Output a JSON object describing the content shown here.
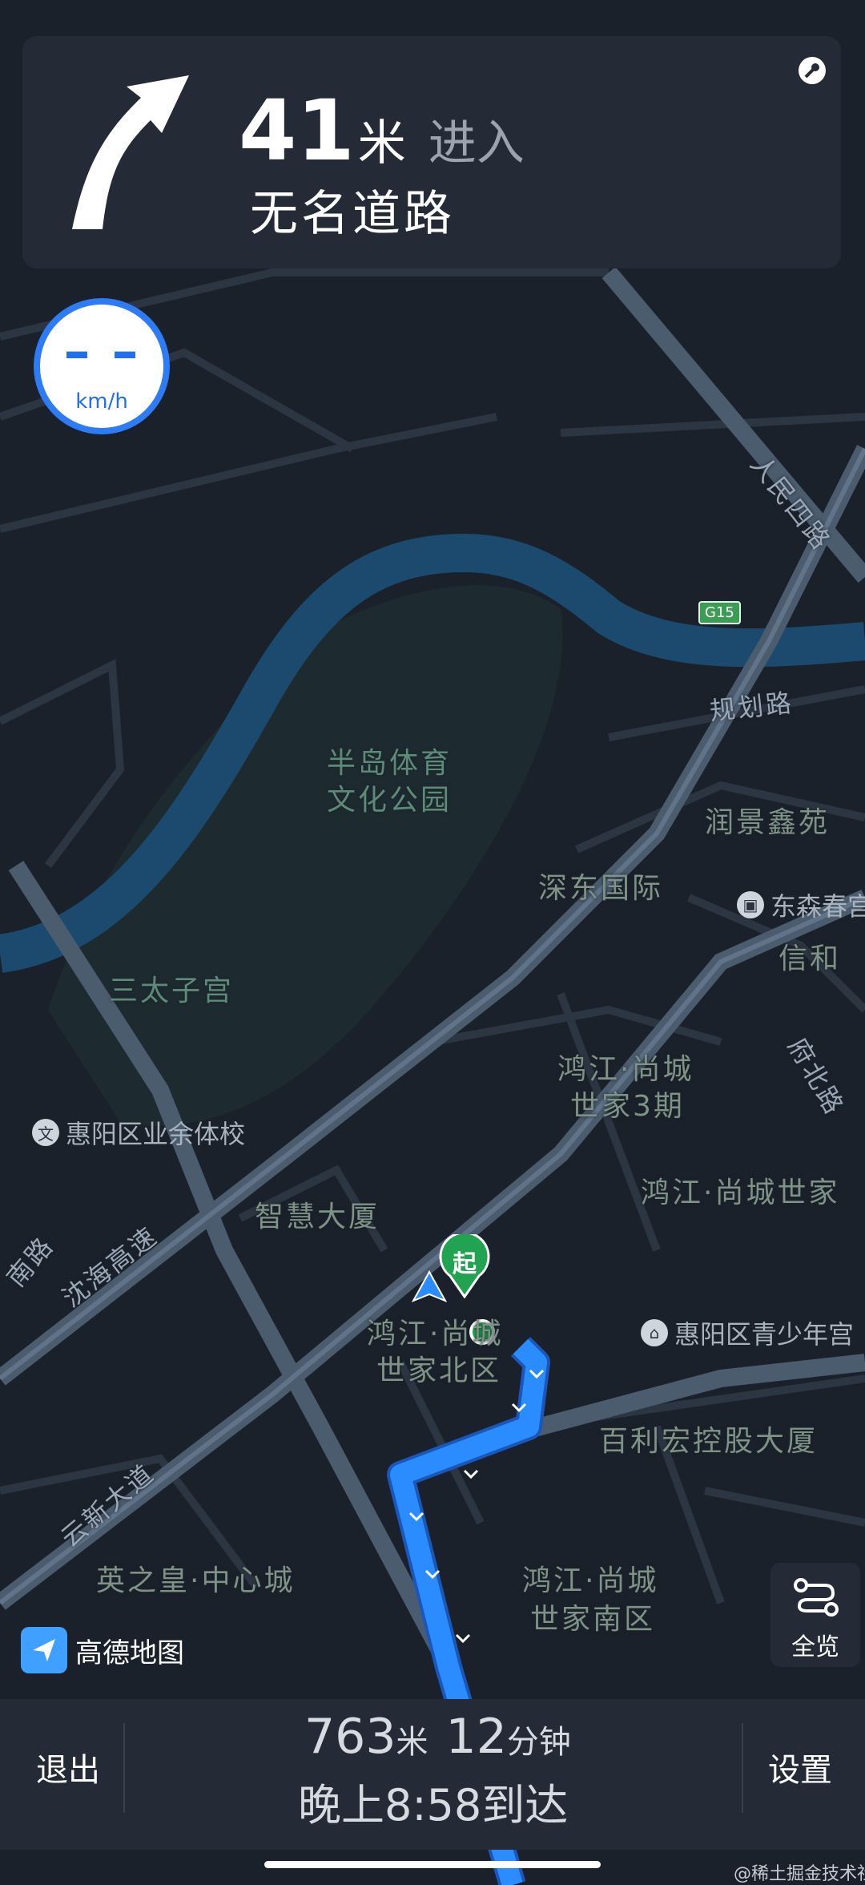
{
  "nav": {
    "distance_value": "41",
    "distance_unit": "米",
    "action": "进入",
    "road_name": "无名道路"
  },
  "speed": {
    "value": "– –",
    "unit": "km/h"
  },
  "map_labels": {
    "park": [
      "半岛体育",
      "文化公园"
    ],
    "sanzigong": "三太子宫",
    "shendong": "深东国际",
    "runjing": "润景鑫苑",
    "xinhe": "信和",
    "hongjiang3_a": "鸿江·尚城",
    "hongjiang3_b": "世家3期",
    "hongjiang_world": "鸿江·尚城世家",
    "zhihui": "智慧大厦",
    "hongjiang_north_a": "鸿江·尚城",
    "hongjiang_north_b": "世家北区",
    "baili": "百利宏控股大厦",
    "hongjiang_south_a": "鸿江·尚城",
    "hongjiang_south_b": "世家南区",
    "yingzhi": "英之皇·中心城",
    "poi_school": "惠阳区业余体校",
    "poi_dongsen": "东森春宫",
    "poi_youth": "惠阳区青少年宫"
  },
  "road_labels": {
    "renmin": "人民四路",
    "guihua": "规划路",
    "fubei": "府北路",
    "shenhai": "沈海高速",
    "yunxin": "云新大道",
    "nanlu": "南路",
    "highway_shield": "G15"
  },
  "markers": {
    "start": "起"
  },
  "brand": {
    "name": "高德地图"
  },
  "overview": {
    "label": "全览"
  },
  "bottom": {
    "exit": "退出",
    "settings": "设置",
    "remain_distance": "763",
    "remain_distance_unit": "米",
    "remain_time": "12",
    "remain_time_unit": "分钟",
    "eta": "晚上8:58到达"
  },
  "watermark": "@稀土掘金技术社区",
  "colors": {
    "background": "#1b212b",
    "card": "#252b36",
    "route": "#2b8cff",
    "river": "#1c4a6e",
    "major_road": "#55667a",
    "start_marker": "#22a352"
  }
}
